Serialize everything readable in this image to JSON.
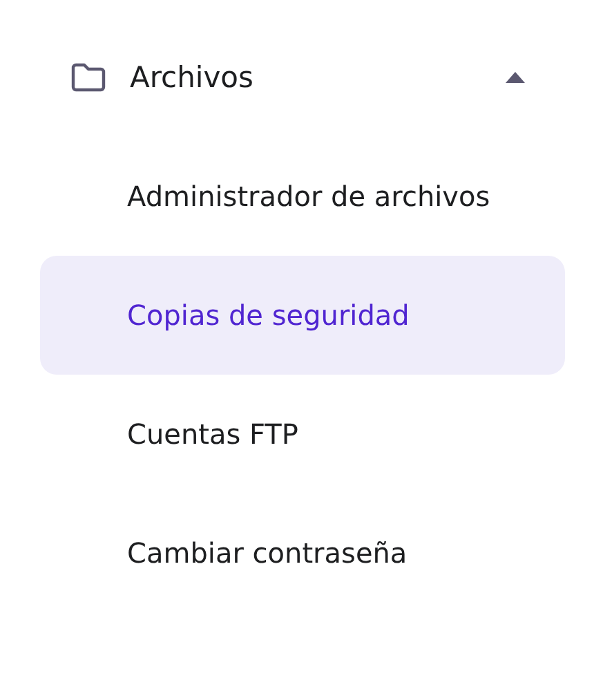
{
  "section": {
    "label": "Archivos",
    "expanded": true
  },
  "items": [
    {
      "label": "Administrador de archivos",
      "selected": false
    },
    {
      "label": "Copias de seguridad",
      "selected": true
    },
    {
      "label": "Cuentas FTP",
      "selected": false
    },
    {
      "label": "Cambiar contraseña",
      "selected": false
    }
  ]
}
